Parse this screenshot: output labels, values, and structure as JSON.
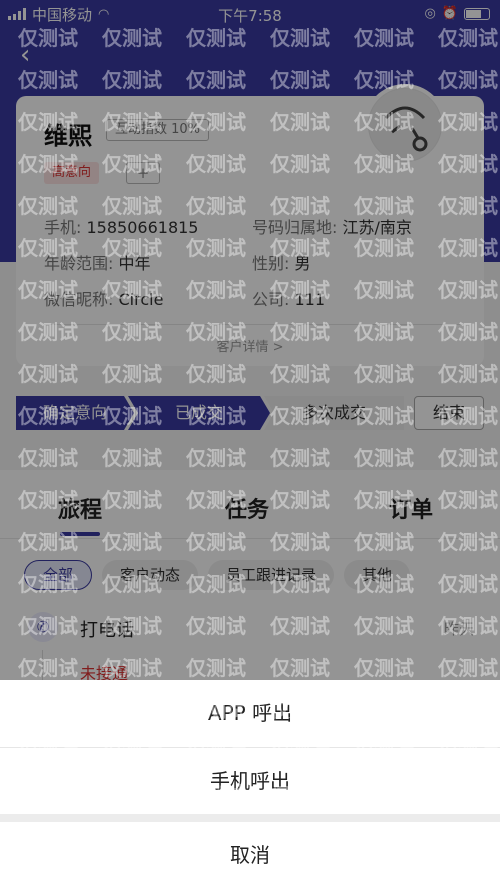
{
  "status_bar": {
    "carrier": "中国移动",
    "time": "下午7:58"
  },
  "customer": {
    "name": "维熙",
    "interaction_index": "互动指数 10%",
    "intent_tag": "高意向",
    "add_tag": "+",
    "phone_label": "手机:",
    "phone_value": "15850661815",
    "location_label": "号码归属地:",
    "location_value": "江苏/南京",
    "age_label": "年龄范围:",
    "age_value": "中年",
    "gender_label": "性别:",
    "gender_value": "男",
    "wechat_label": "微信昵称:",
    "wechat_value": "Circle",
    "company_label": "公司:",
    "company_value": "111",
    "detail_link": "客户详情 >"
  },
  "pipeline": {
    "steps": [
      "确定意向",
      "已成交",
      "多次成交"
    ],
    "end_button": "结束"
  },
  "tabs": [
    "旅程",
    "任务",
    "订单"
  ],
  "filters": [
    "全部",
    "客户动态",
    "员工跟进记录",
    "其他"
  ],
  "timeline": {
    "title": "打电话",
    "time": "昨天",
    "status": "未接通"
  },
  "action_sheet": {
    "app_call": "APP 呼出",
    "phone_call": "手机呼出",
    "cancel": "取消"
  },
  "watermark_text": "仅测试"
}
